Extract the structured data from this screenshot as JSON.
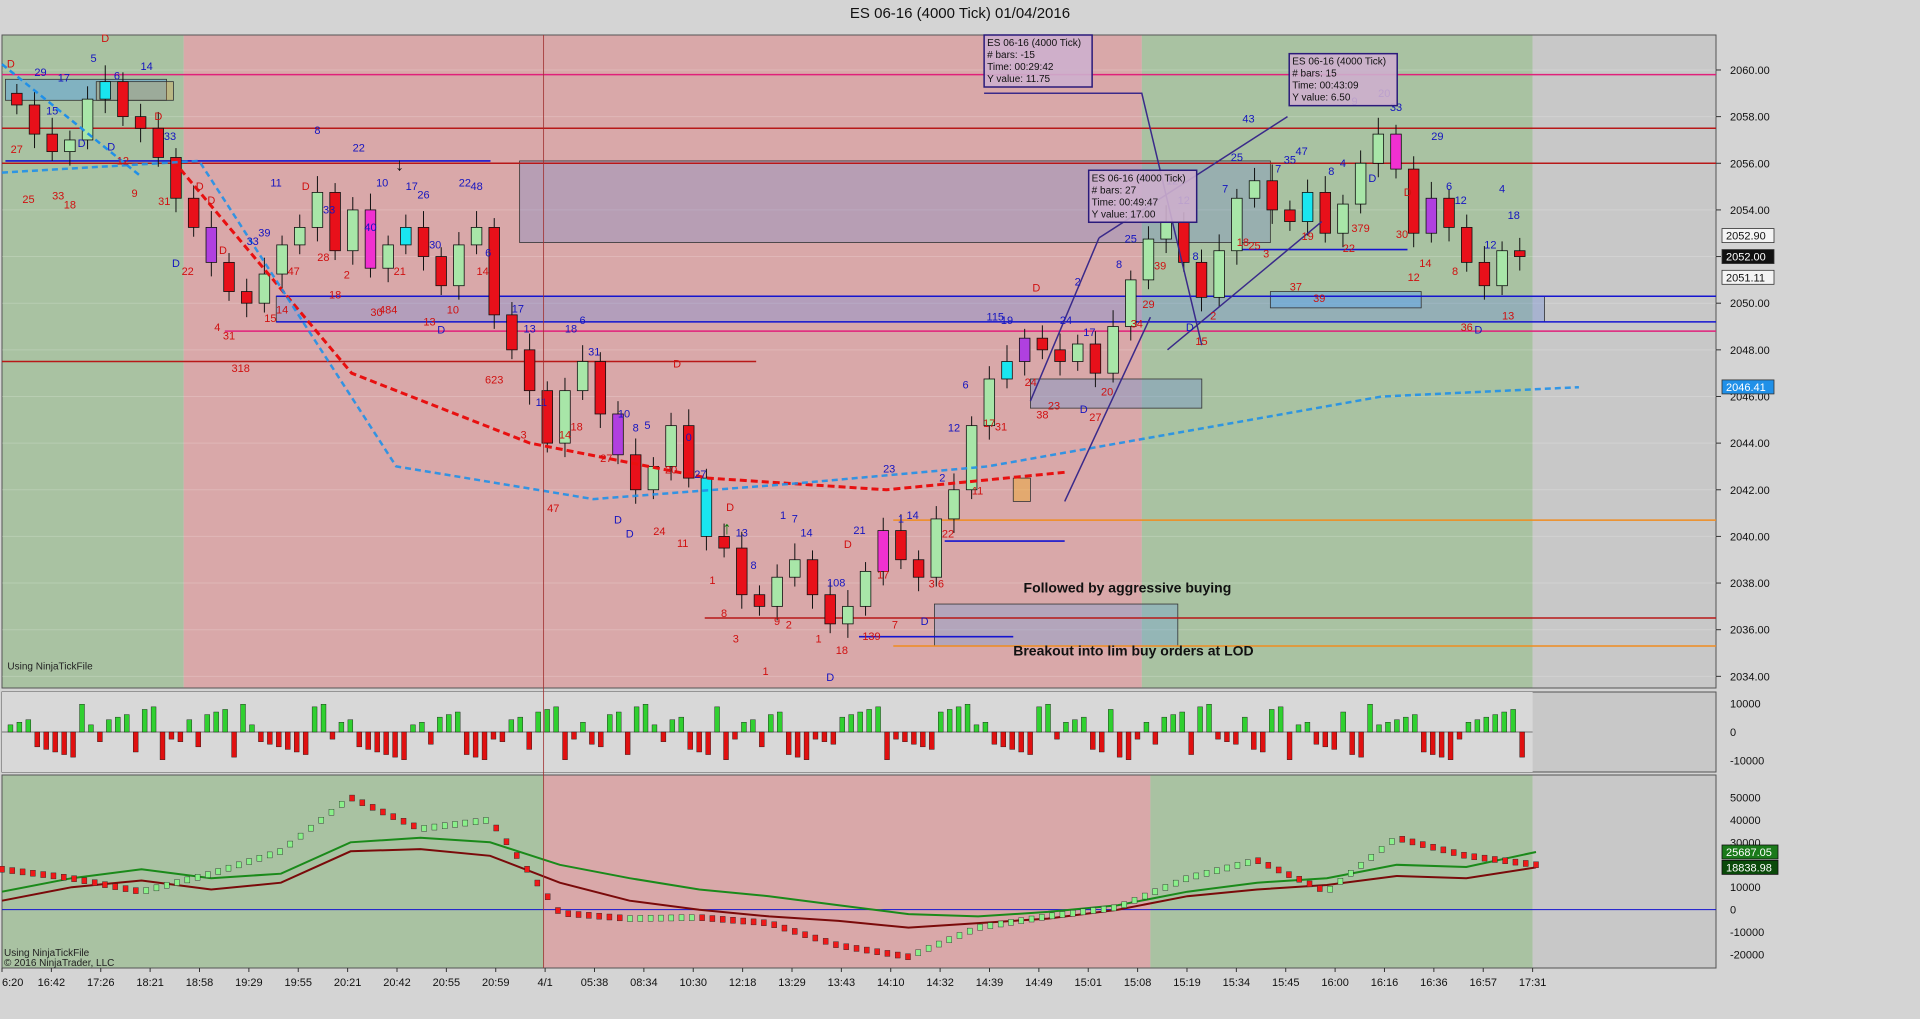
{
  "window": {
    "title": "ES 06-16 (4000 Tick)  01/04/2016"
  },
  "colors": {
    "bg_green": "#a9c2a2",
    "bg_red": "#d9a8a9",
    "bg_panel": "#c8c8c8",
    "up_candle": "#a8e6a8",
    "down_candle": "#e8101a",
    "cyan_candle": "#19e6f0",
    "purple_candle": "#b040e0",
    "magenta_candle": "#f030d0",
    "blue_line": "#1414d0",
    "red_line": "#b81818",
    "pink_line": "#e0207a",
    "orange_line": "#f08c20",
    "ema_red": "#e81010",
    "ema_blue": "#2090e8"
  },
  "chart_data": [
    {
      "type": "candlestick",
      "title": "ES 06-16 (4000 Tick)  01/04/2016",
      "ylim": [
        2033.5,
        2061.5
      ],
      "y_ticks": [
        2034,
        2036,
        2038,
        2040,
        2042,
        2044,
        2046,
        2048,
        2050,
        2052,
        2054,
        2056,
        2058,
        2060
      ],
      "price_tags": [
        {
          "value": 2052.9,
          "label": "2052.90",
          "style": "light"
        },
        {
          "value": 2052.0,
          "label": "2052.00",
          "style": "dark"
        },
        {
          "value": 2051.11,
          "label": "2051.11",
          "style": "light"
        },
        {
          "value": 2046.41,
          "label": "2046.41",
          "style": "blue"
        }
      ],
      "x_labels": [
        "6:20",
        "16:42",
        "17:26",
        "18:21",
        "18:58",
        "19:29",
        "19:55",
        "20:21",
        "20:42",
        "20:55",
        "20:59",
        "4/1",
        "05:38",
        "08:34",
        "10:30",
        "12:18",
        "13:29",
        "13:43",
        "14:10",
        "14:32",
        "14:39",
        "14:49",
        "15:01",
        "15:08",
        "15:19",
        "15:34",
        "15:45",
        "16:00",
        "16:16",
        "16:36",
        "16:57",
        "17:31"
      ],
      "close_path": [
        2058.5,
        2057.25,
        2056.5,
        2057.0,
        2058.75,
        2059.5,
        2058.0,
        2057.5,
        2056.25,
        2054.5,
        2053.25,
        2051.75,
        2050.5,
        2050.0,
        2051.25,
        2052.5,
        2053.25,
        2054.75,
        2052.25,
        2054.0,
        2051.5,
        2052.5,
        2053.25,
        2052.0,
        2050.75,
        2052.5,
        2053.25,
        2049.5,
        2048.0,
        2046.25,
        2044.0,
        2046.25,
        2047.5,
        2045.25,
        2043.5,
        2042.0,
        2043.0,
        2044.75,
        2042.5,
        2040.0,
        2039.5,
        2037.5,
        2037.0,
        2038.25,
        2039.0,
        2037.5,
        2036.25,
        2037.0,
        2038.5,
        2040.25,
        2039.0,
        2038.25,
        2040.75,
        2042.0,
        2044.75,
        2046.75,
        2047.5,
        2048.5,
        2048.0,
        2047.5,
        2048.25,
        2047.0,
        2049.0,
        2051.0,
        2052.75,
        2053.5,
        2051.75,
        2050.25,
        2052.25,
        2054.5,
        2055.25,
        2054.0,
        2053.5,
        2054.75,
        2053.0,
        2054.25,
        2056.0,
        2057.25,
        2055.75,
        2053.0,
        2054.5,
        2053.25,
        2051.75,
        2050.75,
        2052.25,
        2052.0
      ],
      "series": [
        {
          "name": "",
          "values": [
            2060.25,
            2055.5
          ]
        },
        {
          "name": "",
          "values": [
            2056.1,
            2047.0,
            2044.0,
            2042.5,
            2042.0,
            2042.75
          ]
        },
        {
          "name": "",
          "values": [
            2055.6,
            2056.1,
            2043.0,
            2041.6,
            2042.25,
            2043.0,
            2044.5,
            2046.0,
            2046.4
          ]
        }
      ],
      "levels": [
        {
          "value": 2059.8,
          "color": "pink",
          "start": 0.0
        },
        {
          "value": 2057.5,
          "color": "red",
          "start": 0.0
        },
        {
          "value": 2056.0,
          "color": "red",
          "start": 0.0
        },
        {
          "value": 2050.3,
          "color": "blue",
          "start": 0.16
        },
        {
          "value": 2049.2,
          "color": "blue",
          "start": 0.16
        },
        {
          "value": 2048.8,
          "color": "pink",
          "start": 0.13
        },
        {
          "value": 2047.5,
          "color": "red",
          "start": 0.0,
          "end": 0.44
        },
        {
          "value": 2040.7,
          "color": "orange",
          "start": 0.52
        },
        {
          "value": 2036.5,
          "color": "red",
          "start": 0.41
        },
        {
          "value": 2035.3,
          "color": "orange",
          "start": 0.52
        }
      ],
      "annotations": [
        {
          "text": "Followed by aggressive buying",
          "x": 0.596,
          "y": 2037.6
        },
        {
          "text": "Breakout into lim buy orders at LOD",
          "x": 0.59,
          "y": 2034.9
        },
        {
          "text": "Using NinjaTickFile",
          "x": 0.002,
          "y": 2034.3
        }
      ],
      "measure_boxes": [
        {
          "lines": [
            "ES 06-16 (4000 Tick)",
            "# bars:   -15",
            "Time:     00:29:42",
            "Y value: 11.75"
          ],
          "x": 0.573,
          "y": 2061.5
        },
        {
          "lines": [
            "ES 06-16 (4000 Tick)",
            "# bars:   27",
            "Time:     00:49:47",
            "Y value: 17.00"
          ],
          "x": 0.634,
          "y": 2055.7
        },
        {
          "lines": [
            "ES 06-16 (4000 Tick)",
            "# bars:   15",
            "Time:     00:43:09",
            "Y value: 6.50"
          ],
          "x": 0.751,
          "y": 2060.7
        }
      ],
      "bar_labels": [
        "D",
        "27",
        "29",
        "25",
        "15",
        "33",
        "17",
        "18",
        "5",
        "D",
        "D",
        "D",
        "6",
        "12",
        "14",
        "9",
        "D",
        "31",
        "33",
        "D",
        "D",
        "22",
        "D",
        "4",
        "D",
        "31",
        "33",
        "318",
        "39",
        "15",
        "11",
        "14",
        "D",
        "47",
        "8",
        "28",
        "33",
        "18",
        "22",
        "2",
        "40",
        "30",
        "10",
        "484",
        "17",
        "21",
        "26",
        "13",
        "30",
        "D",
        "22",
        "10",
        "48",
        "14",
        "6",
        "623",
        "17",
        "3",
        "13",
        "47",
        "11",
        "14",
        "18",
        "18",
        "6",
        "27",
        "31",
        "D",
        "10",
        "D",
        "8",
        "24",
        "5",
        "20",
        "D",
        "11",
        "0",
        "1",
        "27",
        "8",
        "D",
        "3",
        "13",
        "1",
        "8",
        "9",
        "1",
        "2",
        "7",
        "1",
        "14",
        "D",
        "108",
        "18",
        "D",
        "139",
        "21",
        "17",
        "23",
        "7",
        "1",
        "D",
        "14",
        "3 6",
        "2",
        "22",
        "12",
        "11",
        "6",
        "17",
        "115",
        "31",
        "19",
        "24",
        "D",
        "38",
        "24",
        "23",
        "2",
        "D",
        "17",
        "27",
        "8",
        "20",
        "25",
        "34",
        "45",
        "29",
        "12",
        "39",
        "12",
        "D",
        "8",
        "15",
        "7",
        "2",
        "25",
        "18",
        "43",
        "25",
        "7",
        "3",
        "35",
        "37",
        "47",
        "19",
        "8",
        "39",
        "4",
        "22",
        "9",
        "379",
        "20",
        "D",
        "33",
        "30",
        "D",
        "12",
        "29",
        "14",
        "6",
        "8",
        "12",
        "36",
        "12",
        "D",
        "4",
        "13",
        "18"
      ]
    },
    {
      "type": "bar",
      "title": "",
      "ylim": [
        -14000,
        14000
      ],
      "y_ticks": [
        10000,
        0,
        -10000
      ],
      "y_tick_labels": [
        "10000",
        "0",
        "-10000"
      ]
    },
    {
      "type": "line",
      "title": "",
      "ylim": [
        -26000,
        60000
      ],
      "y_ticks": [
        50000,
        40000,
        30000,
        20000,
        10000,
        0,
        -10000,
        -20000
      ],
      "price_tags": [
        {
          "value": 25687.05,
          "label": "25687.05"
        },
        {
          "value": 18838.98,
          "label": "18838.98"
        }
      ],
      "series": [
        {
          "name": "",
          "values": [
            18000,
            14000,
            8000,
            16000,
            26000,
            50000,
            36000,
            40000,
            -1500,
            -4000,
            -3500,
            -6000,
            -16000,
            -21000,
            -8000,
            -3000,
            1000,
            14000,
            22000,
            8000,
            32000,
            24000,
            20000
          ]
        },
        {
          "name": "",
          "values": [
            4000,
            10000,
            13000,
            9000,
            12000,
            26000,
            27000,
            24000,
            12000,
            4000,
            0,
            -3000,
            -5000,
            -8000,
            -6000,
            -4000,
            0,
            6000,
            9000,
            11000,
            15000,
            14000,
            18838.98
          ]
        },
        {
          "name": "",
          "values": [
            8000,
            14000,
            18000,
            14000,
            16000,
            30000,
            32000,
            30000,
            20000,
            14000,
            9000,
            6000,
            2000,
            -2000,
            -3000,
            -1000,
            2000,
            8000,
            12000,
            14000,
            20000,
            19000,
            25687.05
          ]
        }
      ]
    }
  ],
  "footer": {
    "copyright": "© 2016 NinjaTrader, LLC",
    "tick_file_label": "Using NinjaTickFile"
  }
}
